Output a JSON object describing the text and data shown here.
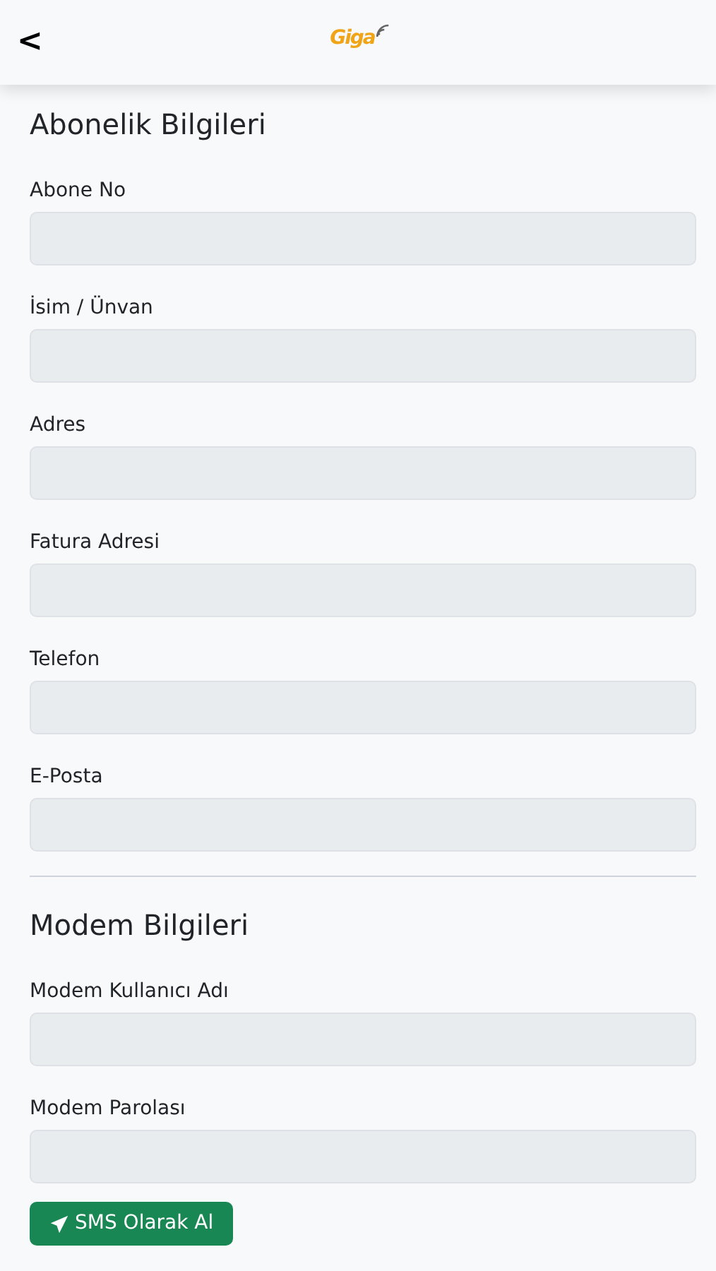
{
  "header": {
    "back": "<",
    "logo": "Giga"
  },
  "sections": [
    {
      "title": "Abonelik Bilgileri",
      "fields": [
        {
          "label": "Abone No"
        },
        {
          "label": "İsim / Ünvan"
        },
        {
          "label": "Adres"
        },
        {
          "label": "Fatura Adresi"
        },
        {
          "label": "Telefon"
        },
        {
          "label": "E-Posta"
        }
      ]
    },
    {
      "title": "Modem Bilgileri",
      "fields": [
        {
          "label": "Modem Kullanıcı Adı"
        },
        {
          "label": "Modem Parolası"
        }
      ]
    }
  ],
  "button": {
    "label": "SMS Olarak Al"
  }
}
